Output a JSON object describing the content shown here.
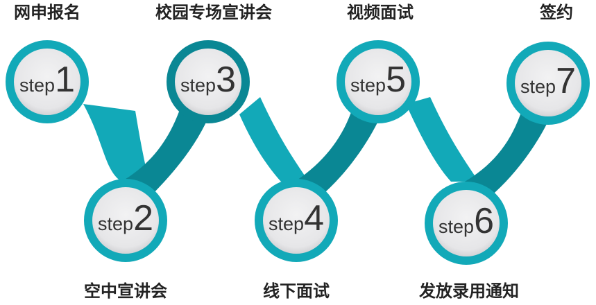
{
  "steps": [
    {
      "word": "step",
      "number": "1",
      "title": "网申报名"
    },
    {
      "word": "step",
      "number": "2",
      "title": "空中宣讲会"
    },
    {
      "word": "step",
      "number": "3",
      "title": "校园专场宣讲会"
    },
    {
      "word": "step",
      "number": "4",
      "title": "线下面试"
    },
    {
      "word": "step",
      "number": "5",
      "title": "视频面试"
    },
    {
      "word": "step",
      "number": "6",
      "title": "发放录用通知"
    },
    {
      "word": "step",
      "number": "7",
      "title": "签约"
    }
  ],
  "colors": {
    "ring": "#12a9b8",
    "ring_dark": "#0a8794",
    "inner": "#eaeaec",
    "inner_shadow": "#c9c9cc",
    "text": "#333333",
    "label": "#222222"
  }
}
